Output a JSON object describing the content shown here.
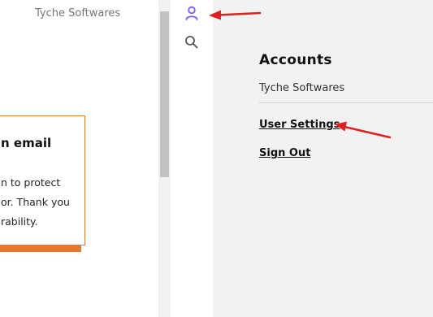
{
  "left_page": {
    "brand": "Tyche Softwares",
    "notice": {
      "heading": "n email",
      "lines": [
        "n to protect",
        "or. Thank you",
        "rability."
      ]
    }
  },
  "icon_rail": {
    "account_icon": "user-icon",
    "search_icon": "search-icon",
    "active_color": "#7b5cf5"
  },
  "accounts_panel": {
    "title": "Accounts",
    "organization": "Tyche Softwares",
    "links": {
      "user_settings": "User Settings",
      "sign_out": "Sign Out"
    }
  },
  "colors": {
    "accent_orange": "#e8772e",
    "annotation_red": "#e02020",
    "panel_bg": "#f2f2f2"
  }
}
